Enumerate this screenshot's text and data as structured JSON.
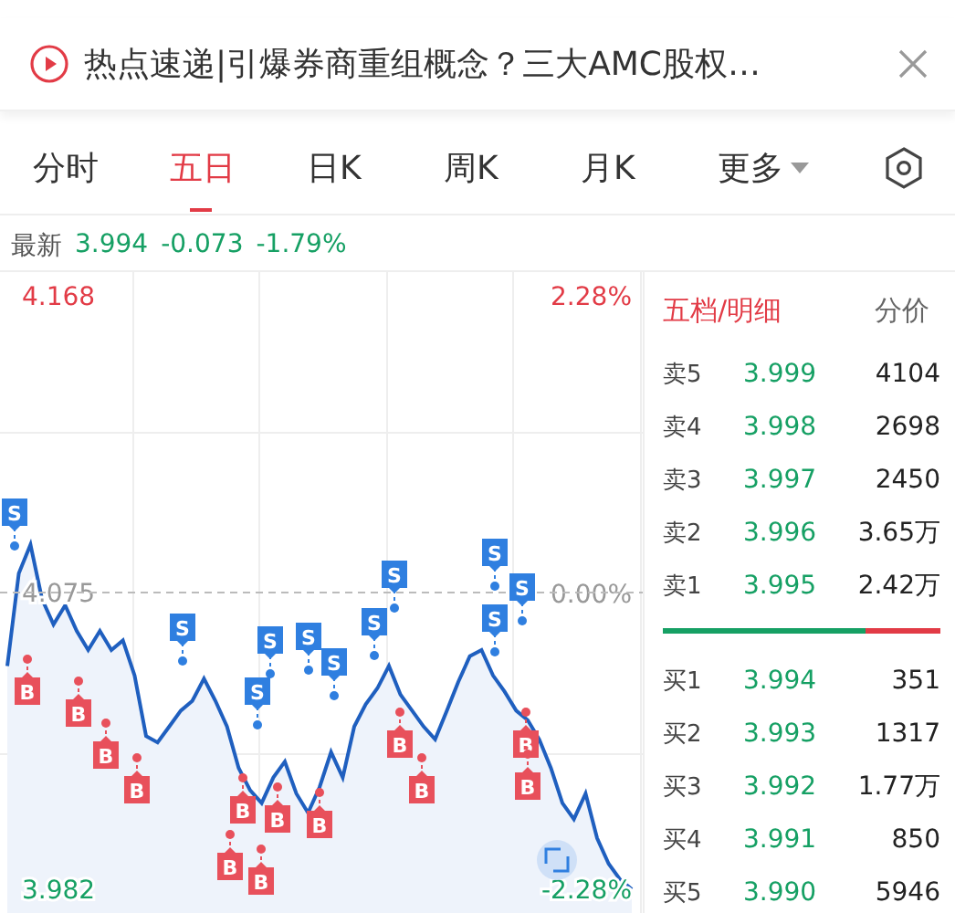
{
  "banner": {
    "title": "热点速递|引爆券商重组概念？三大AMC股权…"
  },
  "tabs": [
    {
      "label": "分时",
      "selected": false
    },
    {
      "label": "五日",
      "selected": true
    },
    {
      "label": "日K",
      "selected": false
    },
    {
      "label": "周K",
      "selected": false
    },
    {
      "label": "月K",
      "selected": false
    },
    {
      "label": "更多",
      "selected": false,
      "kind": "dropdown"
    }
  ],
  "quote": {
    "label": "最新",
    "price": "3.994",
    "change": "-0.073",
    "percent": "-1.79%"
  },
  "chart": {
    "high_pct": "2.28%",
    "base_pct": "0.00%",
    "low_pct": "-2.28%",
    "chart_data": {
      "type": "area",
      "ylim": [
        3.982,
        4.168
      ],
      "grid": true,
      "yticks": [
        {
          "value": 4.168,
          "label": "4.168"
        },
        {
          "value": 4.075,
          "label": "4.075"
        },
        {
          "value": 3.982,
          "label": "3.982"
        }
      ],
      "categories": [
        null,
        null,
        null,
        null,
        null,
        null,
        null,
        null,
        null,
        null,
        null,
        null,
        null,
        null,
        null,
        null,
        null,
        null,
        null,
        null,
        null,
        null,
        null,
        null,
        null,
        null,
        null,
        null,
        null,
        null,
        null,
        null,
        null,
        null,
        null,
        null,
        null,
        null,
        null,
        null,
        null,
        null,
        null,
        null,
        null,
        null,
        null,
        null,
        null,
        null,
        null,
        null,
        null,
        null,
        null
      ],
      "series": [
        {
          "color": "#1f5fbf",
          "values": [
            4.052,
            4.081,
            4.09,
            4.073,
            4.065,
            4.071,
            4.063,
            4.057,
            4.063,
            4.057,
            4.06,
            4.049,
            4.03,
            4.028,
            4.033,
            4.038,
            4.041,
            4.048,
            4.041,
            4.033,
            4.02,
            4.013,
            4.009,
            4.017,
            4.022,
            4.012,
            4.006,
            4.014,
            4.025,
            4.017,
            4.033,
            4.04,
            4.045,
            4.052,
            4.043,
            4.038,
            4.033,
            4.029,
            4.038,
            4.047,
            4.055,
            4.057,
            4.049,
            4.044,
            4.038,
            4.035,
            4.029,
            4.02,
            4.009,
            4.004,
            4.012,
            3.998,
            3.99,
            3.985,
            3.982
          ]
        }
      ]
    },
    "markers": [
      {
        "kind": "sell",
        "label": "S"
      },
      {
        "kind": "sell",
        "label": "S"
      },
      {
        "kind": "sell",
        "label": "S"
      },
      {
        "kind": "sell",
        "label": "S"
      },
      {
        "kind": "sell",
        "label": "S"
      },
      {
        "kind": "sell",
        "label": "S"
      },
      {
        "kind": "sell",
        "label": "S"
      },
      {
        "kind": "sell",
        "label": "S"
      },
      {
        "kind": "sell",
        "label": "S"
      },
      {
        "kind": "sell",
        "label": "S"
      },
      {
        "kind": "sell",
        "label": "S"
      },
      {
        "kind": "buy",
        "label": "B"
      },
      {
        "kind": "buy",
        "label": "B"
      },
      {
        "kind": "buy",
        "label": "B"
      },
      {
        "kind": "buy",
        "label": "B"
      },
      {
        "kind": "buy",
        "label": "B"
      },
      {
        "kind": "buy",
        "label": "B"
      },
      {
        "kind": "buy",
        "label": "B"
      },
      {
        "kind": "buy",
        "label": "B"
      },
      {
        "kind": "buy",
        "label": "B"
      },
      {
        "kind": "buy",
        "label": "B"
      },
      {
        "kind": "buy",
        "label": "B"
      },
      {
        "kind": "buy",
        "label": "B"
      },
      {
        "kind": "buy",
        "label": "B"
      }
    ]
  },
  "panel": {
    "tabs": [
      {
        "label": "五档/明细",
        "selected": true
      },
      {
        "label": "分价",
        "selected": false
      }
    ],
    "asks": [
      {
        "label": "卖5",
        "price": "3.999",
        "volume": "4104"
      },
      {
        "label": "卖4",
        "price": "3.998",
        "volume": "2698"
      },
      {
        "label": "卖3",
        "price": "3.997",
        "volume": "2450"
      },
      {
        "label": "卖2",
        "price": "3.996",
        "volume": "3.65万"
      },
      {
        "label": "卖1",
        "price": "3.995",
        "volume": "2.42万"
      }
    ],
    "ratio_bar": {
      "level": 0.73
    },
    "bids": [
      {
        "label": "买1",
        "price": "3.994",
        "volume": "351"
      },
      {
        "label": "买2",
        "price": "3.993",
        "volume": "1317"
      },
      {
        "label": "买3",
        "price": "3.992",
        "volume": "1.77万"
      },
      {
        "label": "买4",
        "price": "3.991",
        "volume": "850"
      },
      {
        "label": "买5",
        "price": "3.990",
        "volume": "5946"
      }
    ]
  }
}
